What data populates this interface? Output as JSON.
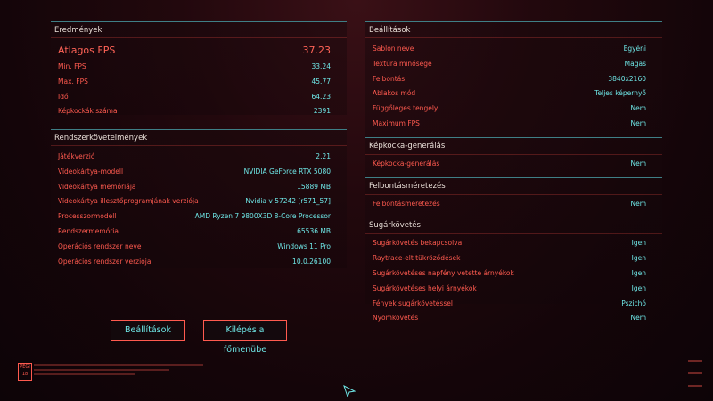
{
  "results": {
    "title": "Eredmények",
    "rows": [
      {
        "label": "Átlagos FPS",
        "value": "37.23"
      },
      {
        "label": "Min. FPS",
        "value": "33.24"
      },
      {
        "label": "Max. FPS",
        "value": "45.77"
      },
      {
        "label": "Idő",
        "value": "64.23"
      },
      {
        "label": "Képkockák száma",
        "value": "2391"
      }
    ]
  },
  "system": {
    "title": "Rendszerkövetelmények",
    "rows": [
      {
        "label": "Játékverzió",
        "value": "2.21"
      },
      {
        "label": "Videokártya-modell",
        "value": "NVIDIA GeForce RTX 5080"
      },
      {
        "label": "Videokártya memóriája",
        "value": "15889 MB"
      },
      {
        "label": "Videokártya illesztőprogramjának verziója",
        "value": "Nvidia v 57242 [r571_57]"
      },
      {
        "label": "Processzormodell",
        "value": "AMD Ryzen 7 9800X3D 8-Core Processor"
      },
      {
        "label": "Rendszermemória",
        "value": "65536 MB"
      },
      {
        "label": "Operációs rendszer neve",
        "value": "Windows 11 Pro"
      },
      {
        "label": "Operációs rendszer verziója",
        "value": "10.0.26100"
      }
    ]
  },
  "settings": {
    "title": "Beállítások",
    "rows": [
      {
        "label": "Sablon neve",
        "value": "Egyéni"
      },
      {
        "label": "Textúra minősége",
        "value": "Magas"
      },
      {
        "label": "Felbontás",
        "value": "3840x2160"
      },
      {
        "label": "Ablakos mód",
        "value": "Teljes képernyő"
      },
      {
        "label": "Függőleges tengely",
        "value": "Nem"
      },
      {
        "label": "Maximum FPS",
        "value": "Nem"
      }
    ]
  },
  "frame_gen": {
    "title": "Képkocka-generálás",
    "rows": [
      {
        "label": "Képkocka-generálás",
        "value": "Nem"
      }
    ]
  },
  "upscaling": {
    "title": "Felbontásméretezés",
    "rows": [
      {
        "label": "Felbontásméretezés",
        "value": "Nem"
      }
    ]
  },
  "raytracing": {
    "title": "Sugárkövetés",
    "rows": [
      {
        "label": "Sugárkövetés bekapcsolva",
        "value": "Igen"
      },
      {
        "label": "Raytrace-elt tükröződések",
        "value": "Igen"
      },
      {
        "label": "Sugárkövetéses napfény vetette árnyékok",
        "value": "Igen"
      },
      {
        "label": "Sugárkövetéses helyi árnyékok",
        "value": "Igen"
      },
      {
        "label": "Fények sugárkövetéssel",
        "value": "Pszichó"
      },
      {
        "label": "Nyomkövetés",
        "value": "Nem"
      }
    ]
  },
  "buttons": {
    "settings_label": "Beállítások",
    "exit_label": "Kilépés a főmenübe"
  },
  "legal_badge": "PEGI 18",
  "colors": {
    "accent_red": "#ff5a4f",
    "value_cyan": "#6ee6e6",
    "border_teal": "#3f7f86",
    "title_text": "#e9dfd8"
  }
}
